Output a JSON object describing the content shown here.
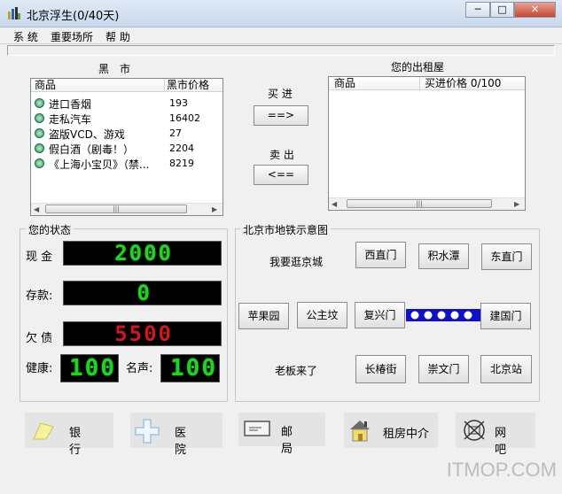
{
  "window": {
    "title": "北京浮生(0/40天)"
  },
  "menu": [
    "系 统",
    "重要场所",
    "帮 助"
  ],
  "black_market": {
    "heading": "黑　市",
    "columns": [
      "商品",
      "黑市价格"
    ],
    "rows": [
      {
        "name": "进口香烟",
        "price": "193"
      },
      {
        "name": "走私汽车",
        "price": "16402"
      },
      {
        "name": "盗版VCD、游戏",
        "price": "27"
      },
      {
        "name": "假白酒（剧毒！）",
        "price": "2204"
      },
      {
        "name": "《上海小宝贝》（禁...",
        "price": "8219"
      }
    ]
  },
  "trade": {
    "buy_label": "买 进",
    "buy_btn": "==>",
    "sell_label": "卖 出",
    "sell_btn": "<=="
  },
  "rented": {
    "heading": "您的出租屋",
    "columns": [
      "商品",
      "买进价格 0/100"
    ]
  },
  "status": {
    "title": "您的状态",
    "cash_label": "现 金",
    "cash": "2000",
    "deposit_label": "存款:",
    "deposit": "0",
    "debt_label": "欠 债",
    "debt": "5500",
    "health_label": "健康:",
    "health": "100",
    "fame_label": "名声:",
    "fame": "100"
  },
  "subway": {
    "title": "北京市地铁示意图",
    "tour_text": "我要逛京城",
    "boss_text": "老板来了",
    "stations": {
      "xizhimen": "西直门",
      "jishuitan": "积水潭",
      "dongzhimen": "东直门",
      "pingguoyuan": "苹果园",
      "gongzhufen": "公主坟",
      "fuxingmen": "复兴门",
      "jianguomen": "建国门",
      "changchunjie": "长椿街",
      "chongwenmen": "崇文门",
      "beijingzhan": "北京站"
    }
  },
  "places": {
    "bank": "银 行",
    "hospital": "医 院",
    "post": "邮 局",
    "rental": "租房中介",
    "netcafe": "网 吧"
  },
  "watermark": "ITMOP.COM",
  "colors": {
    "lcd_green": "#1fd41f",
    "lcd_red": "#d01818",
    "subway_track": "#1010c8"
  }
}
